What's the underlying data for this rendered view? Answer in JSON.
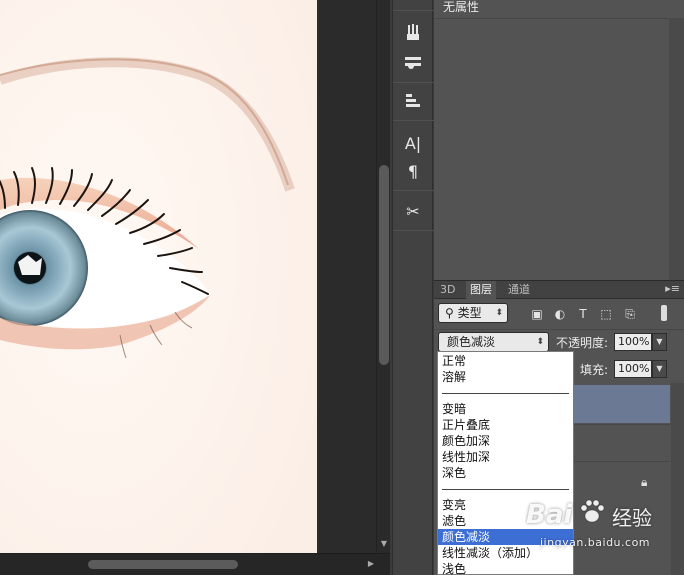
{
  "properties_panel": {
    "title": "无属性"
  },
  "layers_panel": {
    "tabs": [
      {
        "label": "3D",
        "active": false
      },
      {
        "label": "图层",
        "active": true
      },
      {
        "label": "通道",
        "active": false
      }
    ],
    "menu_icon": "panel-menu-icon",
    "filter": {
      "selected": "类型",
      "icons": [
        "image-filter-icon",
        "adjustment-filter-icon",
        "type-filter-icon",
        "shape-filter-icon",
        "smart-object-filter-icon"
      ]
    },
    "blend_mode": {
      "selected": "颜色减淡"
    },
    "opacity": {
      "label": "不透明度:",
      "value": "100%"
    },
    "fill": {
      "label": "填充:",
      "value": "100%"
    },
    "selected_layer_color": "#6b7994"
  },
  "blend_dropdown": {
    "groups": [
      [
        "正常",
        "溶解"
      ],
      [
        "变暗",
        "正片叠底",
        "颜色加深",
        "线性加深",
        "深色"
      ],
      [
        "变亮",
        "滤色",
        "颜色减淡",
        "线性减淡（添加）",
        "浅色"
      ]
    ],
    "selected": "颜色减淡",
    "highlight_color": "#3d6ed4"
  },
  "toolstrip": {
    "tools": [
      "brush-preset-icon",
      "tool-presets-icon",
      "layer-comps-icon",
      "character-icon",
      "paragraph-icon",
      "tools-icon"
    ]
  },
  "watermark": {
    "logo_text": "Bai",
    "logo_text_2": "经验",
    "url": "jingyan.baidu.com"
  }
}
